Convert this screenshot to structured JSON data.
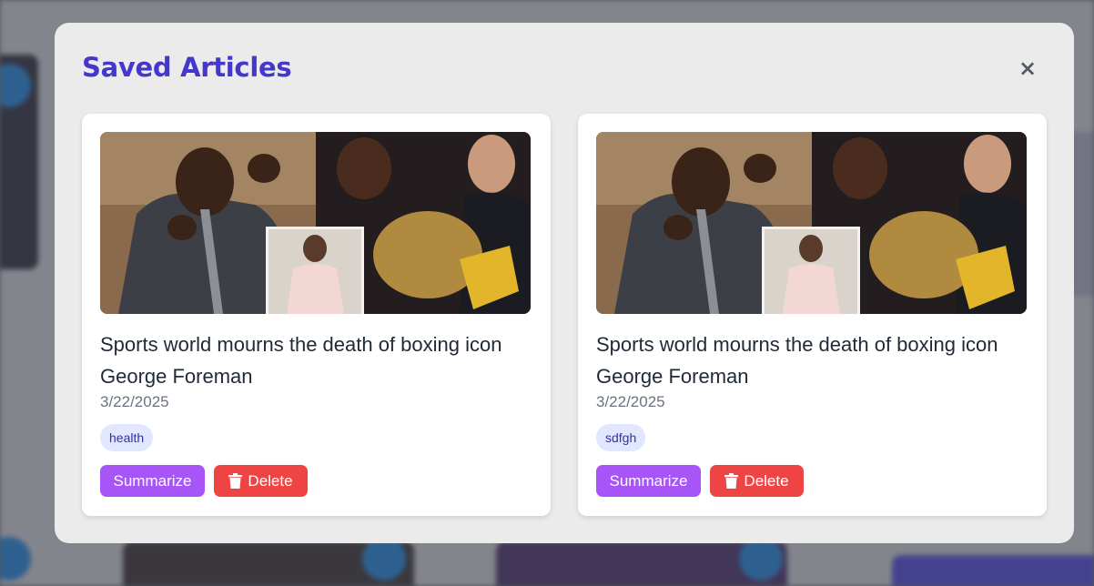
{
  "modal": {
    "title": "Saved Articles",
    "close_label": "×"
  },
  "articles": [
    {
      "title": "Sports world mourns the death of boxing icon George Foreman",
      "date": "3/22/2025",
      "tag": "health",
      "summarize_label": "Summarize",
      "delete_label": "Delete"
    },
    {
      "title": "Sports world mourns the death of boxing icon George Foreman",
      "date": "3/22/2025",
      "tag": "sdfgh",
      "summarize_label": "Summarize",
      "delete_label": "Delete"
    }
  ],
  "icons": {
    "close": "close-icon",
    "delete": "trash-icon"
  },
  "colors": {
    "title": "#4338ca",
    "summarize": "#a855f7",
    "delete": "#ef4444",
    "tag_bg": "#e0e7ff"
  }
}
